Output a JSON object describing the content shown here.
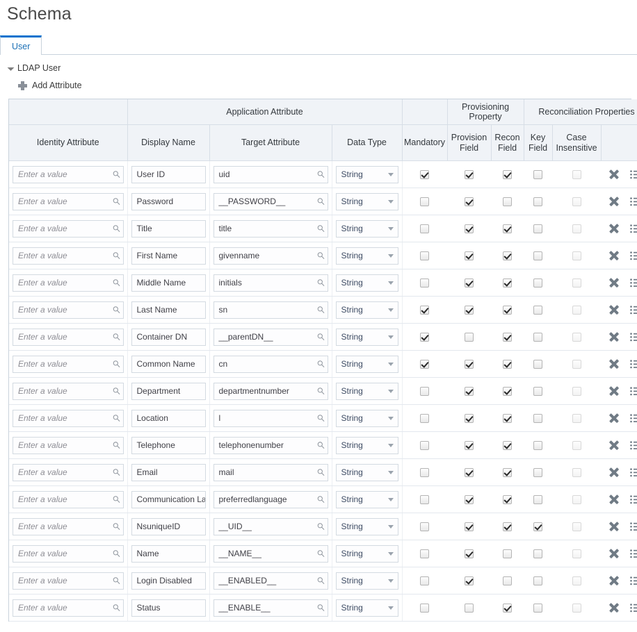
{
  "page": {
    "title": "Schema"
  },
  "tabs": [
    {
      "label": "User",
      "active": true
    }
  ],
  "tree": {
    "node_label": "LDAP User"
  },
  "toolbar": {
    "add_attribute_label": "Add Attribute"
  },
  "colors": {
    "accent": "#0572ce",
    "tab_text": "#1a6fb5",
    "header_bg": "#f0f3f7",
    "border": "#c9d3dc"
  },
  "table": {
    "group_headers": [
      {
        "label": "",
        "span": 1
      },
      {
        "label": "Application Attribute",
        "span": 3
      },
      {
        "label": "",
        "span": 1
      },
      {
        "label": "Provisioning Property",
        "span": 2
      },
      {
        "label": "Reconciliation Properties",
        "span": 3
      },
      {
        "label": "",
        "span": 1
      }
    ],
    "columns": [
      {
        "key": "identity_attribute",
        "label": "Identity Attribute"
      },
      {
        "key": "display_name",
        "label": "Display Name"
      },
      {
        "key": "target_attribute",
        "label": "Target Attribute"
      },
      {
        "key": "data_type",
        "label": "Data Type"
      },
      {
        "key": "mandatory",
        "label": "Mandatory"
      },
      {
        "key": "provision_field",
        "label": "Provision Field"
      },
      {
        "key": "recon_field",
        "label": "Recon Field"
      },
      {
        "key": "key_field",
        "label": "Key Field"
      },
      {
        "key": "case_insensitive",
        "label": "Case Insensitive"
      },
      {
        "key": "actions",
        "label": ""
      }
    ],
    "identity_placeholder": "Enter a value",
    "icons": {
      "search": "search-icon",
      "dropdown": "chevron-down-icon",
      "delete": "delete-x-icon",
      "list": "list-icon",
      "add": "plus-icon",
      "disclosure": "triangle-expanded-icon"
    },
    "rows": [
      {
        "identity_attribute": "",
        "display_name": "User ID",
        "target_attribute": "uid",
        "data_type": "String",
        "mandatory": true,
        "provision_field": true,
        "recon_field": true,
        "key_field": false,
        "case_insensitive": false
      },
      {
        "identity_attribute": "",
        "display_name": "Password",
        "target_attribute": "__PASSWORD__",
        "data_type": "String",
        "mandatory": false,
        "provision_field": true,
        "recon_field": false,
        "key_field": false,
        "case_insensitive": false
      },
      {
        "identity_attribute": "",
        "display_name": "Title",
        "target_attribute": "title",
        "data_type": "String",
        "mandatory": false,
        "provision_field": true,
        "recon_field": true,
        "key_field": false,
        "case_insensitive": false
      },
      {
        "identity_attribute": "",
        "display_name": "First Name",
        "target_attribute": "givenname",
        "data_type": "String",
        "mandatory": false,
        "provision_field": true,
        "recon_field": true,
        "key_field": false,
        "case_insensitive": false
      },
      {
        "identity_attribute": "",
        "display_name": "Middle Name",
        "target_attribute": "initials",
        "data_type": "String",
        "mandatory": false,
        "provision_field": true,
        "recon_field": true,
        "key_field": false,
        "case_insensitive": false
      },
      {
        "identity_attribute": "",
        "display_name": "Last Name",
        "target_attribute": "sn",
        "data_type": "String",
        "mandatory": true,
        "provision_field": true,
        "recon_field": true,
        "key_field": false,
        "case_insensitive": false
      },
      {
        "identity_attribute": "",
        "display_name": "Container DN",
        "target_attribute": "__parentDN__",
        "data_type": "String",
        "mandatory": true,
        "provision_field": false,
        "recon_field": true,
        "key_field": false,
        "case_insensitive": false
      },
      {
        "identity_attribute": "",
        "display_name": "Common Name",
        "target_attribute": "cn",
        "data_type": "String",
        "mandatory": true,
        "provision_field": true,
        "recon_field": true,
        "key_field": false,
        "case_insensitive": false
      },
      {
        "identity_attribute": "",
        "display_name": "Department",
        "target_attribute": "departmentnumber",
        "data_type": "String",
        "mandatory": false,
        "provision_field": true,
        "recon_field": true,
        "key_field": false,
        "case_insensitive": false
      },
      {
        "identity_attribute": "",
        "display_name": "Location",
        "target_attribute": "l",
        "data_type": "String",
        "mandatory": false,
        "provision_field": true,
        "recon_field": true,
        "key_field": false,
        "case_insensitive": false
      },
      {
        "identity_attribute": "",
        "display_name": "Telephone",
        "target_attribute": "telephonenumber",
        "data_type": "String",
        "mandatory": false,
        "provision_field": true,
        "recon_field": true,
        "key_field": false,
        "case_insensitive": false
      },
      {
        "identity_attribute": "",
        "display_name": "Email",
        "target_attribute": "mail",
        "data_type": "String",
        "mandatory": false,
        "provision_field": true,
        "recon_field": true,
        "key_field": false,
        "case_insensitive": false
      },
      {
        "identity_attribute": "",
        "display_name": "Communication Lan",
        "target_attribute": "preferredlanguage",
        "data_type": "String",
        "mandatory": false,
        "provision_field": true,
        "recon_field": true,
        "key_field": false,
        "case_insensitive": false
      },
      {
        "identity_attribute": "",
        "display_name": "NsuniqueID",
        "target_attribute": "__UID__",
        "data_type": "String",
        "mandatory": false,
        "provision_field": true,
        "recon_field": true,
        "key_field": true,
        "case_insensitive": false
      },
      {
        "identity_attribute": "",
        "display_name": "Name",
        "target_attribute": "__NAME__",
        "data_type": "String",
        "mandatory": false,
        "provision_field": true,
        "recon_field": false,
        "key_field": false,
        "case_insensitive": false
      },
      {
        "identity_attribute": "",
        "display_name": "Login Disabled",
        "target_attribute": "__ENABLED__",
        "data_type": "String",
        "mandatory": false,
        "provision_field": true,
        "recon_field": false,
        "key_field": false,
        "case_insensitive": false
      },
      {
        "identity_attribute": "",
        "display_name": "Status",
        "target_attribute": "__ENABLE__",
        "data_type": "String",
        "mandatory": false,
        "provision_field": false,
        "recon_field": true,
        "key_field": false,
        "case_insensitive": false
      }
    ]
  }
}
